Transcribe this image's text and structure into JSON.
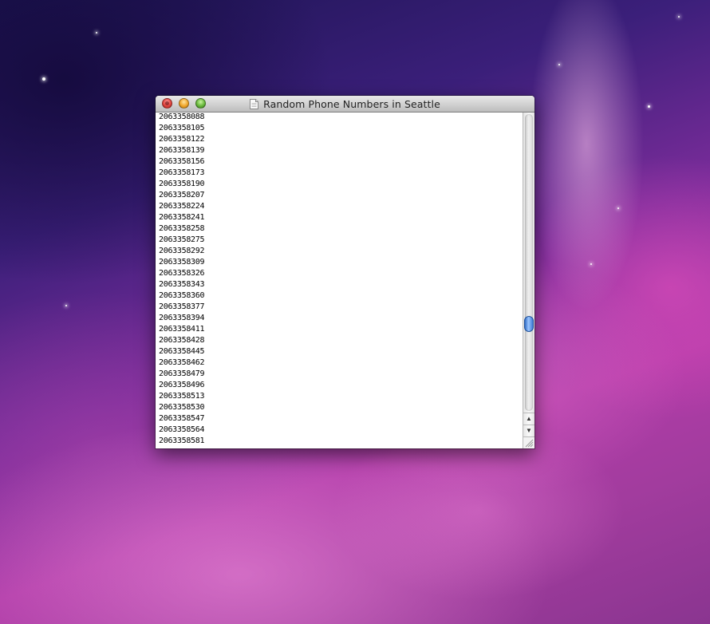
{
  "window": {
    "title": "Random Phone Numbers in Seattle"
  },
  "icons": {
    "document": "document-icon",
    "close": "close-icon",
    "minimize": "minimize-icon",
    "zoom": "zoom-icon",
    "scroll_up": "scroll-up-arrow-icon",
    "scroll_down": "scroll-down-arrow-icon",
    "resize": "resize-grip-icon"
  },
  "colors": {
    "close": "#e0443e",
    "minimize": "#f0a62a",
    "zoom": "#68b83c",
    "scroll_thumb": "#3b79d4"
  },
  "content": {
    "lines": [
      "2063358088",
      "2063358105",
      "2063358122",
      "2063358139",
      "2063358156",
      "2063358173",
      "2063358190",
      "2063358207",
      "2063358224",
      "2063358241",
      "2063358258",
      "2063358275",
      "2063358292",
      "2063358309",
      "2063358326",
      "2063358343",
      "2063358360",
      "2063358377",
      "2063358394",
      "2063358411",
      "2063358428",
      "2063358445",
      "2063358462",
      "2063358479",
      "2063358496",
      "2063358513",
      "2063358530",
      "2063358547",
      "2063358564",
      "2063358581"
    ]
  },
  "scrollbar": {
    "position_fraction": 0.72
  }
}
